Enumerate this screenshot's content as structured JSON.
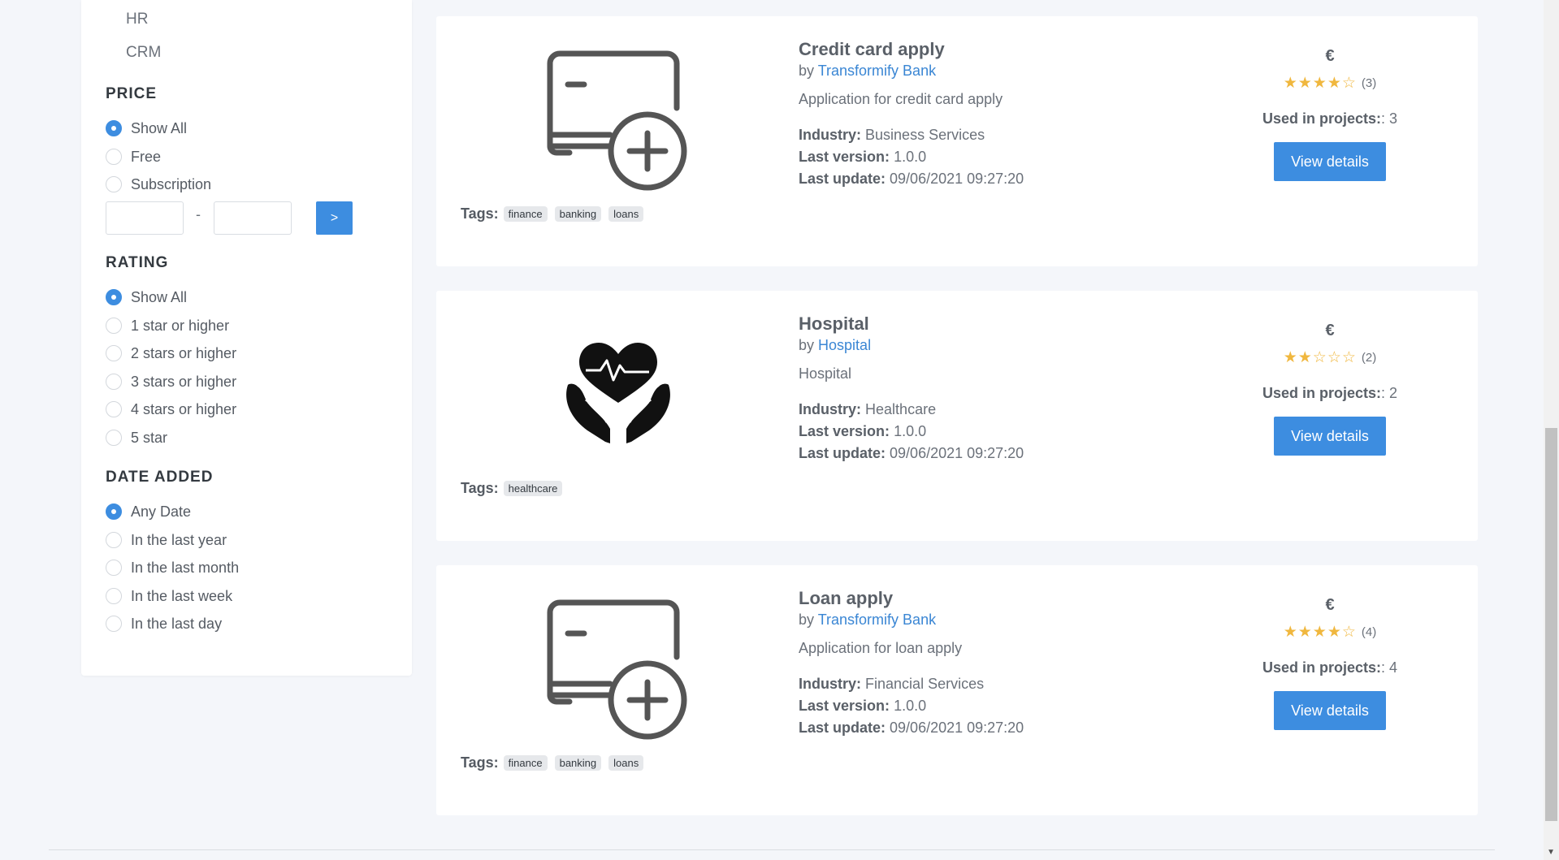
{
  "sidebar": {
    "categories": [
      "HR",
      "CRM"
    ],
    "price": {
      "title": "PRICE",
      "options": [
        "Show All",
        "Free",
        "Subscription"
      ],
      "selected": "Show All",
      "range_separator": "-",
      "go_label": ">"
    },
    "rating": {
      "title": "RATING",
      "options": [
        "Show All",
        "1 star or higher",
        "2 stars or higher",
        "3 stars or higher",
        "4 stars or higher",
        "5 star"
      ],
      "selected": "Show All"
    },
    "date_added": {
      "title": "DATE ADDED",
      "options": [
        "Any Date",
        "In the last year",
        "In the last month",
        "In the last week",
        "In the last day"
      ],
      "selected": "Any Date"
    }
  },
  "cards": [
    {
      "title": "Credit card apply",
      "by": "by",
      "author": "Transformify Bank",
      "description": "Application for credit card apply",
      "industry_label": "Industry:",
      "industry": "Business Services",
      "version_label": "Last version:",
      "version": "1.0.0",
      "update_label": "Last update:",
      "update": "09/06/2021 09:27:20",
      "tags_label": "Tags:",
      "tags": [
        "finance",
        "banking",
        "loans"
      ],
      "currency": "€",
      "stars": "★★★★☆",
      "rating_count": "(3)",
      "rating": 4,
      "used_label": "Used in projects:",
      "used": ": 3",
      "button": "View details",
      "icon": "credit-card-add-icon"
    },
    {
      "title": "Hospital",
      "by": "by",
      "author": "Hospital",
      "description": "Hospital",
      "industry_label": "Industry:",
      "industry": "Healthcare",
      "version_label": "Last version:",
      "version": "1.0.0",
      "update_label": "Last update:",
      "update": "09/06/2021 09:27:20",
      "tags_label": "Tags:",
      "tags": [
        "healthcare"
      ],
      "currency": "€",
      "stars": "★★☆☆☆",
      "rating_count": "(2)",
      "rating": 2,
      "used_label": "Used in projects:",
      "used": ": 2",
      "button": "View details",
      "icon": "heart-hands-icon"
    },
    {
      "title": "Loan apply",
      "by": "by",
      "author": "Transformify Bank",
      "description": "Application for loan apply",
      "industry_label": "Industry:",
      "industry": "Financial Services",
      "version_label": "Last version:",
      "version": "1.0.0",
      "update_label": "Last update:",
      "update": "09/06/2021 09:27:20",
      "tags_label": "Tags:",
      "tags": [
        "finance",
        "banking",
        "loans"
      ],
      "currency": "€",
      "stars": "★★★★☆",
      "rating_count": "(4)",
      "rating": 4,
      "used_label": "Used in projects:",
      "used": ": 4",
      "button": "View details",
      "icon": "credit-card-add-icon"
    }
  ],
  "colors": {
    "accent": "#3d8de0",
    "star": "#f0b73e",
    "link": "#3a86d4"
  }
}
